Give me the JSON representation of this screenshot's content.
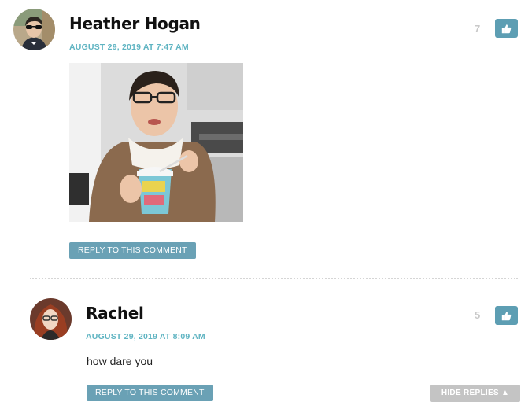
{
  "comments": [
    {
      "author": "Heather Hogan",
      "date": "AUGUST 29, 2019 AT 7:47 AM",
      "votes": "7",
      "reply_label": "REPLY TO THIS COMMENT"
    },
    {
      "author": "Rachel",
      "date": "AUGUST 29, 2019 AT 8:09 AM",
      "votes": "5",
      "text": "how dare you",
      "reply_label": "REPLY TO THIS COMMENT"
    }
  ],
  "hide_replies_label": "HIDE REPLIES ▲",
  "colors": {
    "accent": "#5fb4c2",
    "button": "#6aa1b5",
    "like": "#5d9eb3",
    "muted": "#c4c4c4"
  },
  "icons": {
    "like": "thumbs-up-icon"
  }
}
